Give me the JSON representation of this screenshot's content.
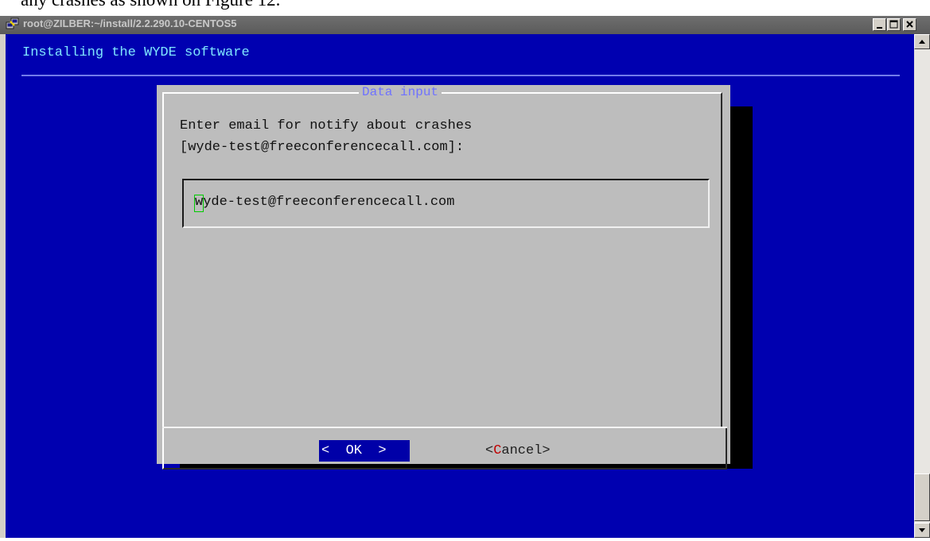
{
  "document": {
    "caption": "any crashes as shown on Figure 12."
  },
  "window": {
    "title": "root@ZILBER:~/install/2.2.290.10-CENTOS5",
    "icon": "putty-icon",
    "controls": [
      "minimize-icon",
      "maximize-icon",
      "close-icon"
    ]
  },
  "terminal": {
    "header": "Installing the WYDE software",
    "colors": {
      "background": "#0000b0",
      "header_text": "#7fe6ff",
      "dialog_bg": "#bdbdbd",
      "dialog_title": "#6f72ff",
      "cursor": "#00cc00",
      "hotkey": "#c00000"
    }
  },
  "dialog": {
    "title": "Data input",
    "prompt_line1": "Enter email for notify about crashes",
    "prompt_line2": "[wyde-test@freeconferencecall.com]:",
    "input_value": "wyde-test@freeconferencecall.com",
    "ok_open": "<",
    "ok_label": "OK",
    "ok_close": ">",
    "cancel_open": "<",
    "cancel_hotkey": "C",
    "cancel_rest": "ancel>"
  }
}
